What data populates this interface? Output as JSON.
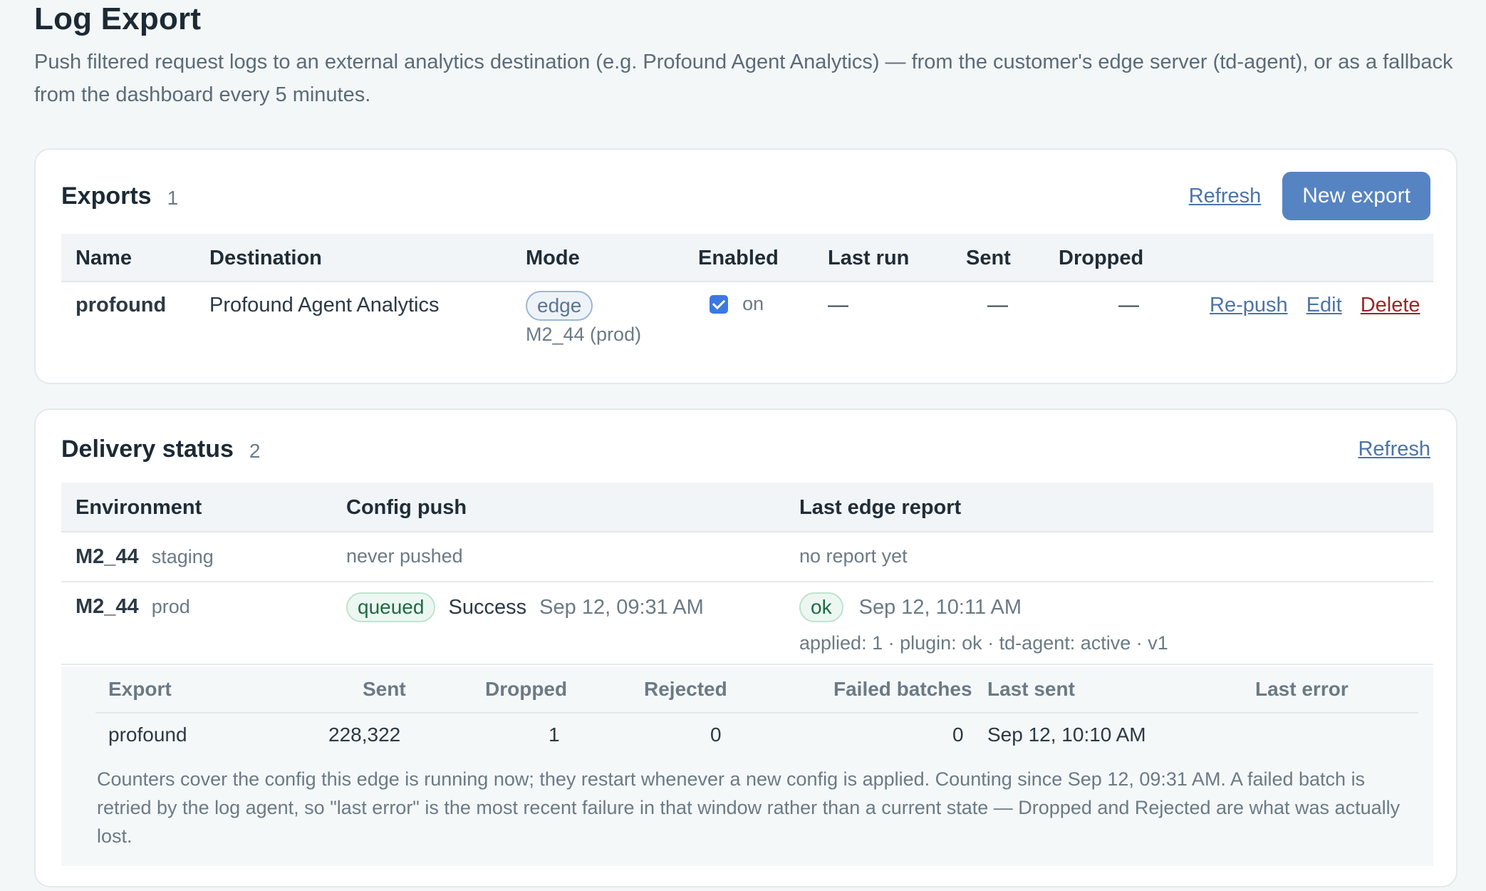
{
  "page": {
    "title": "Log Export",
    "description": "Push filtered request logs to an external analytics destination (e.g. Profound Agent Analytics) — from the customer's edge server (td-agent), or as a fallback from the dashboard every 5 minutes."
  },
  "exports": {
    "title": "Exports",
    "count": "1",
    "refresh_label": "Refresh",
    "new_label": "New export",
    "columns": [
      "Name",
      "Destination",
      "Mode",
      "Enabled",
      "Last run",
      "Sent",
      "Dropped"
    ],
    "rows": [
      {
        "name": "profound",
        "destination": "Profound Agent Analytics",
        "mode": "edge",
        "mode_env": "M2_44 (prod)",
        "enabled": true,
        "enabled_label": "on",
        "last_run": "—",
        "sent": "—",
        "dropped": "—",
        "actions": {
          "repush": "Re-push",
          "edit": "Edit",
          "delete": "Delete"
        }
      }
    ]
  },
  "delivery": {
    "title": "Delivery status",
    "count": "2",
    "refresh_label": "Refresh",
    "columns": [
      "Environment",
      "Config push",
      "Last edge report"
    ],
    "rows": [
      {
        "env": "M2_44",
        "env_tag": "staging",
        "config_push": "never pushed",
        "edge_report": "no report yet"
      },
      {
        "env": "M2_44",
        "env_tag": "prod",
        "push_badge": "queued",
        "push_result": "Success",
        "push_time": "Sep 12, 09:31 AM",
        "report_badge": "ok",
        "report_time": "Sep 12, 10:11 AM",
        "report_detail": "applied: 1 · plugin: ok · td-agent: active · v1"
      }
    ],
    "sub_table": {
      "columns": [
        "Export",
        "Sent",
        "Dropped",
        "Rejected",
        "Failed batches",
        "Last sent",
        "Last error"
      ],
      "rows": [
        {
          "export": "profound",
          "sent": "228,322",
          "dropped": "1",
          "rejected": "0",
          "failed": "0",
          "last_sent": "Sep 12, 10:10 AM",
          "last_error": ""
        }
      ],
      "note": "Counters cover the config this edge is running now; they restart whenever a new config is applied. Counting since Sep 12, 09:31 AM. A failed batch is retried by the log agent, so \"last error\" is the most recent failure in that window rather than a current state — Dropped and Rejected are what was actually lost."
    }
  },
  "colors": {
    "background": "#f4f7f8",
    "primary_button": "#5684c2",
    "link": "#4b74a8",
    "danger": "#9b2424",
    "checkbox": "#3b78e3"
  }
}
